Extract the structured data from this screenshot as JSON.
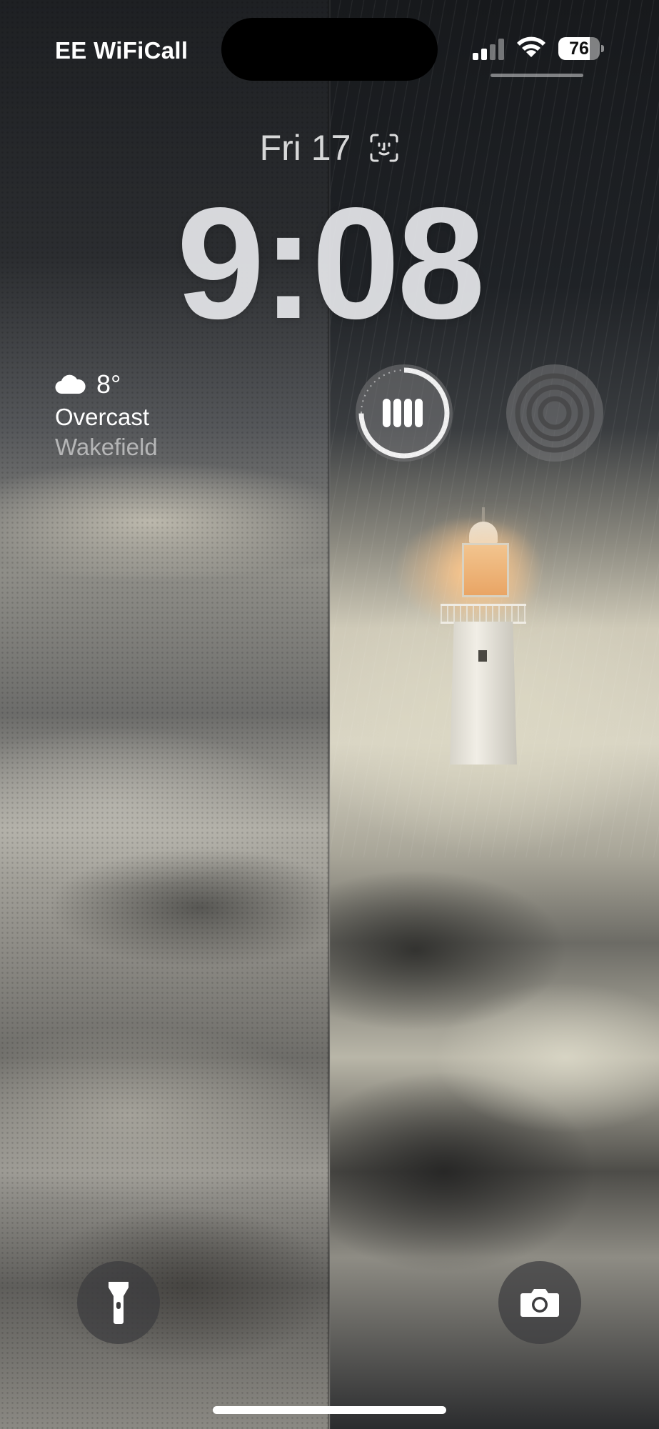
{
  "status_bar": {
    "carrier": "EE WiFiCall",
    "battery_level": "76",
    "battery_fraction": 0.76,
    "signal_bars_active": 2,
    "signal_bars_total": 4
  },
  "lock_screen": {
    "date": "Fri 17",
    "time": "9:08"
  },
  "widgets": {
    "weather": {
      "icon": "cloud-icon",
      "temperature": "8°",
      "condition": "Overcast",
      "location": "Wakefield"
    },
    "battery_ring": {
      "icon": "battery-cells-icon"
    },
    "focus_ring": {
      "icon": "concentric-rings-icon"
    }
  },
  "quick_actions": {
    "left": {
      "icon": "flashlight-icon"
    },
    "right": {
      "icon": "camera-icon"
    }
  },
  "colors": {
    "text": "#ffffff",
    "widget_bg": "#78787a",
    "button_bg": "#3c3c3e"
  }
}
